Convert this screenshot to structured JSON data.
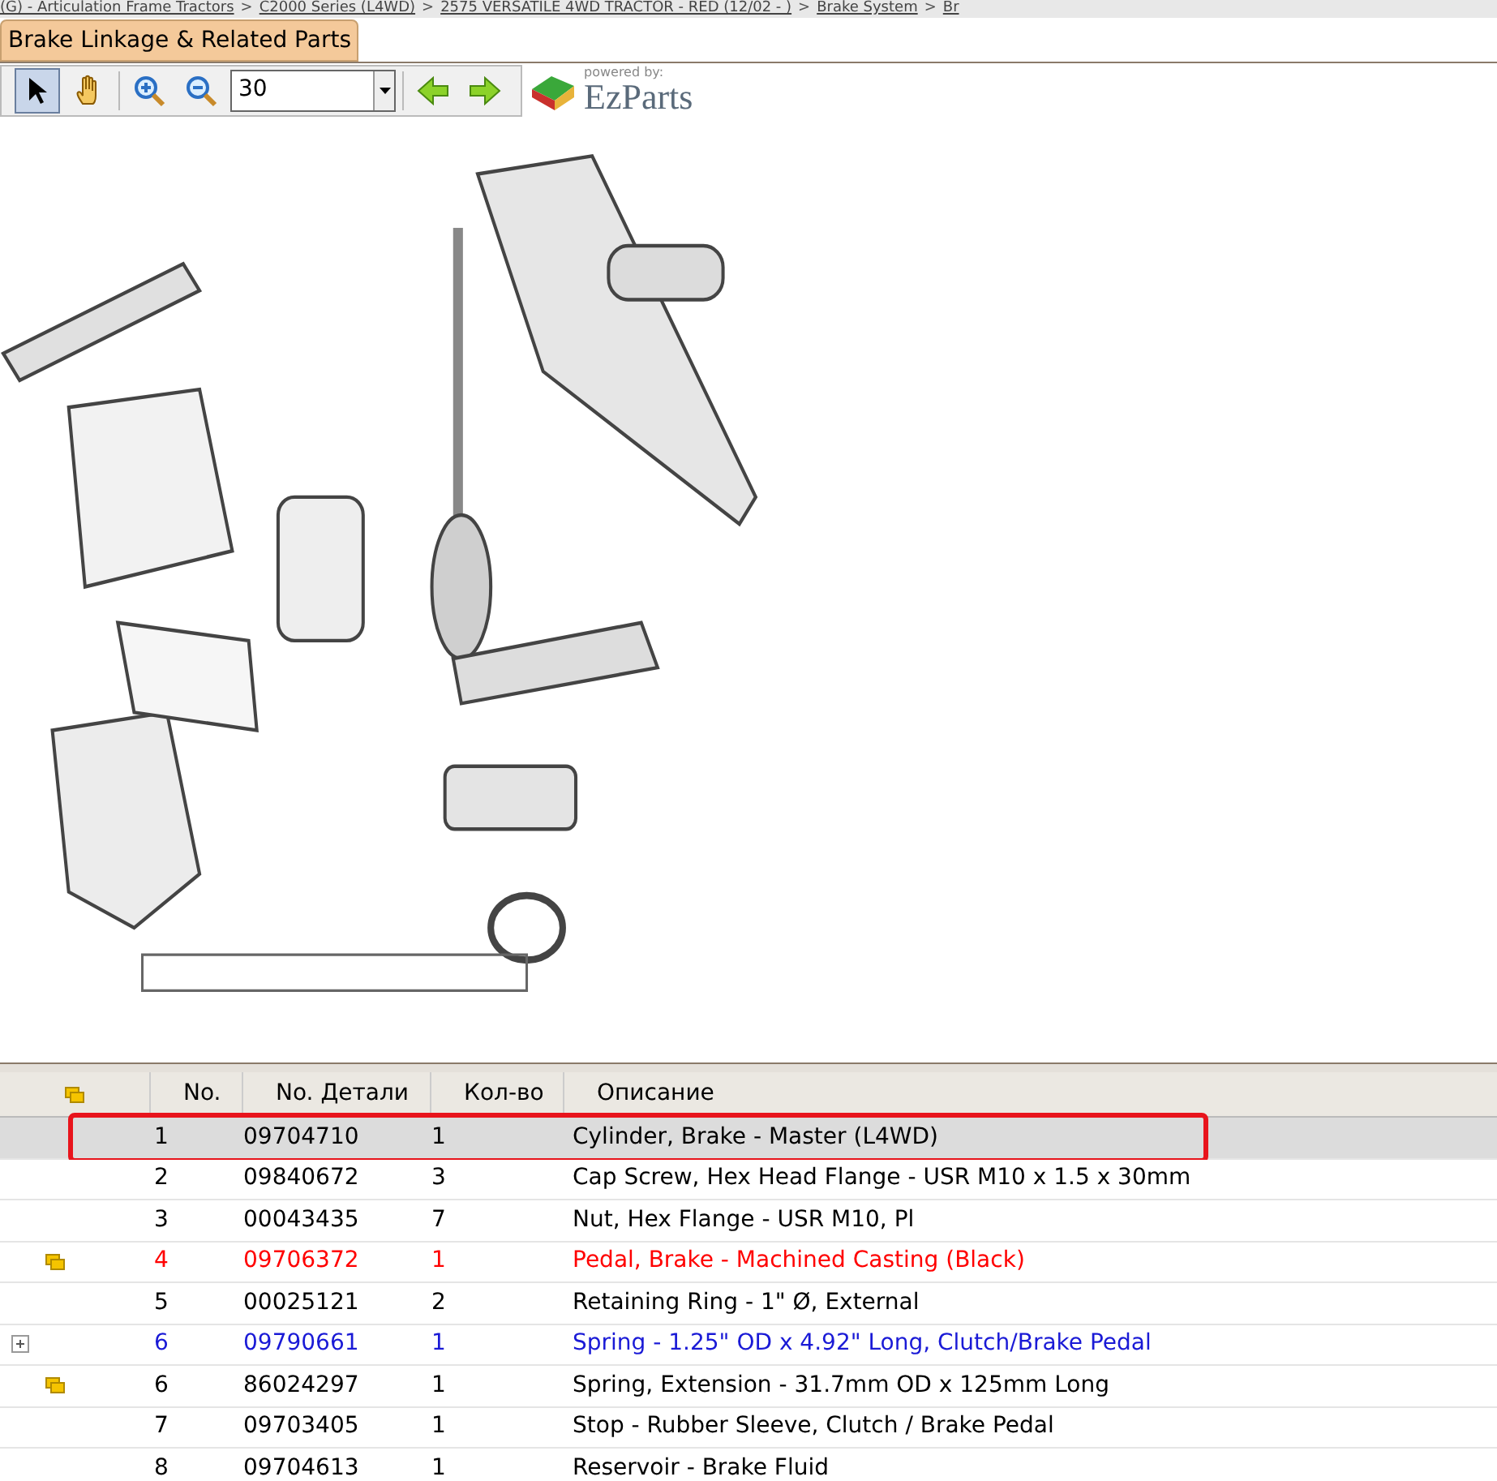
{
  "breadcrumb": [
    {
      "label": "(G) - Articulation Frame Tractors"
    },
    {
      "label": "C2000 Series (L4WD)"
    },
    {
      "label": "2575 VERSATILE 4WD TRACTOR - RED (12/02 - )"
    },
    {
      "label": "Brake System"
    },
    {
      "label": "Br"
    }
  ],
  "breadcrumb_separator": ">",
  "tabs": [
    {
      "label": "Brake Linkage & Related Parts",
      "selected": true
    }
  ],
  "toolbar": {
    "tools": [
      {
        "kind": "pointer",
        "selected": true
      },
      {
        "kind": "hand",
        "selected": false
      },
      {
        "kind": "zoom-in",
        "selected": false
      },
      {
        "kind": "zoom-out",
        "selected": false
      }
    ],
    "zoom_value": "30",
    "logo_tagline": "powered by:",
    "logo_name": "EzParts"
  },
  "diagram": {
    "kind": "picture"
  },
  "table": {
    "columns": [
      "No.",
      "No. Детали",
      "Кол-во",
      "Описание"
    ],
    "rows": [
      {
        "kind": "none",
        "no": "1",
        "part": "09704710",
        "qty": "1",
        "desc": "Cylinder, Brake - Master (L4WD)",
        "color": "#000000",
        "selected": true
      },
      {
        "kind": "none",
        "no": "2",
        "part": "09840672",
        "qty": "3",
        "desc": "Cap Screw, Hex Head Flange - USR M10 x 1.5 x 30mm",
        "color": "#000000",
        "selected": false
      },
      {
        "kind": "none",
        "no": "3",
        "part": "00043435",
        "qty": "7",
        "desc": "Nut, Hex Flange - USR M10, Pl",
        "color": "#000000",
        "selected": false
      },
      {
        "kind": "note",
        "no": "4",
        "part": "09706372",
        "qty": "1",
        "desc": "Pedal, Brake - Machined Casting (Black)",
        "color": "#ff0000",
        "selected": false
      },
      {
        "kind": "none",
        "no": "5",
        "part": "00025121",
        "qty": "2",
        "desc": "Retaining Ring - 1\" Ø, External",
        "color": "#000000",
        "selected": false
      },
      {
        "kind": "expand",
        "no": "6",
        "part": "09790661",
        "qty": "1",
        "desc": "Spring - 1.25\" OD x 4.92\" Long, Clutch/Brake Pedal",
        "color": "#1a1ad6",
        "selected": false
      },
      {
        "kind": "note",
        "no": "6",
        "part": "86024297",
        "qty": "1",
        "desc": "Spring, Extension - 31.7mm OD x 125mm Long",
        "color": "#000000",
        "selected": false
      },
      {
        "kind": "none",
        "no": "7",
        "part": "09703405",
        "qty": "1",
        "desc": "Stop - Rubber Sleeve, Clutch / Brake Pedal",
        "color": "#000000",
        "selected": false
      },
      {
        "kind": "none",
        "no": "8",
        "part": "09704613",
        "qty": "1",
        "desc": "Reservoir - Brake Fluid",
        "color": "#000000",
        "selected": false
      }
    ]
  }
}
